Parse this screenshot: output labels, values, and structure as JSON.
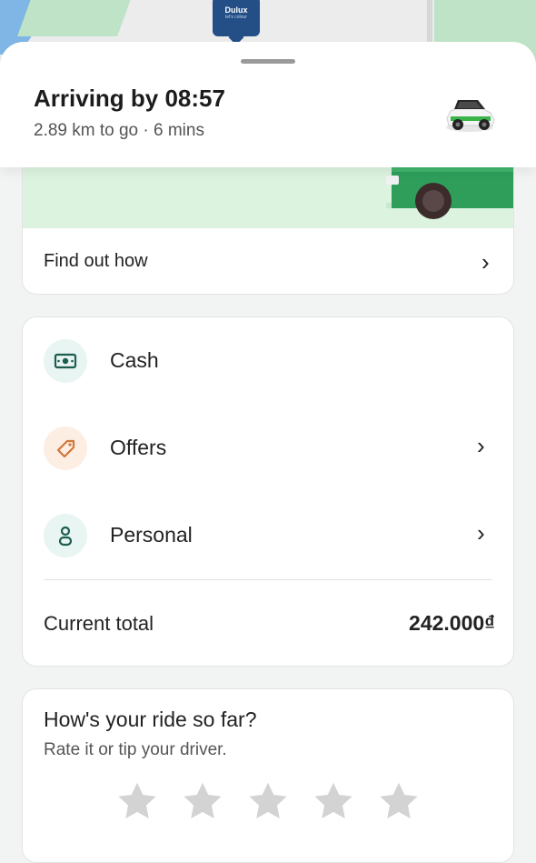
{
  "map": {
    "poi_brand": "Dulux",
    "poi_tagline": "let's colour"
  },
  "trip": {
    "arrival_title": "Arriving by 08:57",
    "distance_time": "2.89 km to go · 6 mins"
  },
  "promo": {
    "find_out_label": "Find out how"
  },
  "payment": {
    "items": [
      {
        "label": "Cash",
        "icon": "cash-icon",
        "icon_bg": "#e8f5f2",
        "icon_color": "#1d5d4f"
      },
      {
        "label": "Offers",
        "icon": "tag-icon",
        "icon_bg": "#fdeee4",
        "icon_color": "#d2763b"
      },
      {
        "label": "Personal",
        "icon": "person-icon",
        "icon_bg": "#e8f5f2",
        "icon_color": "#1d5d4f"
      }
    ],
    "total_label": "Current total",
    "total_value": "242.000₫"
  },
  "rating": {
    "question": "How's your ride so far?",
    "subtitle": "Rate it or tip your driver.",
    "stars_count": 5,
    "star_color": "#d3d3d3"
  },
  "colors": {
    "promo_banner": "#dcf3df",
    "brand_green": "#2f9e5b"
  }
}
